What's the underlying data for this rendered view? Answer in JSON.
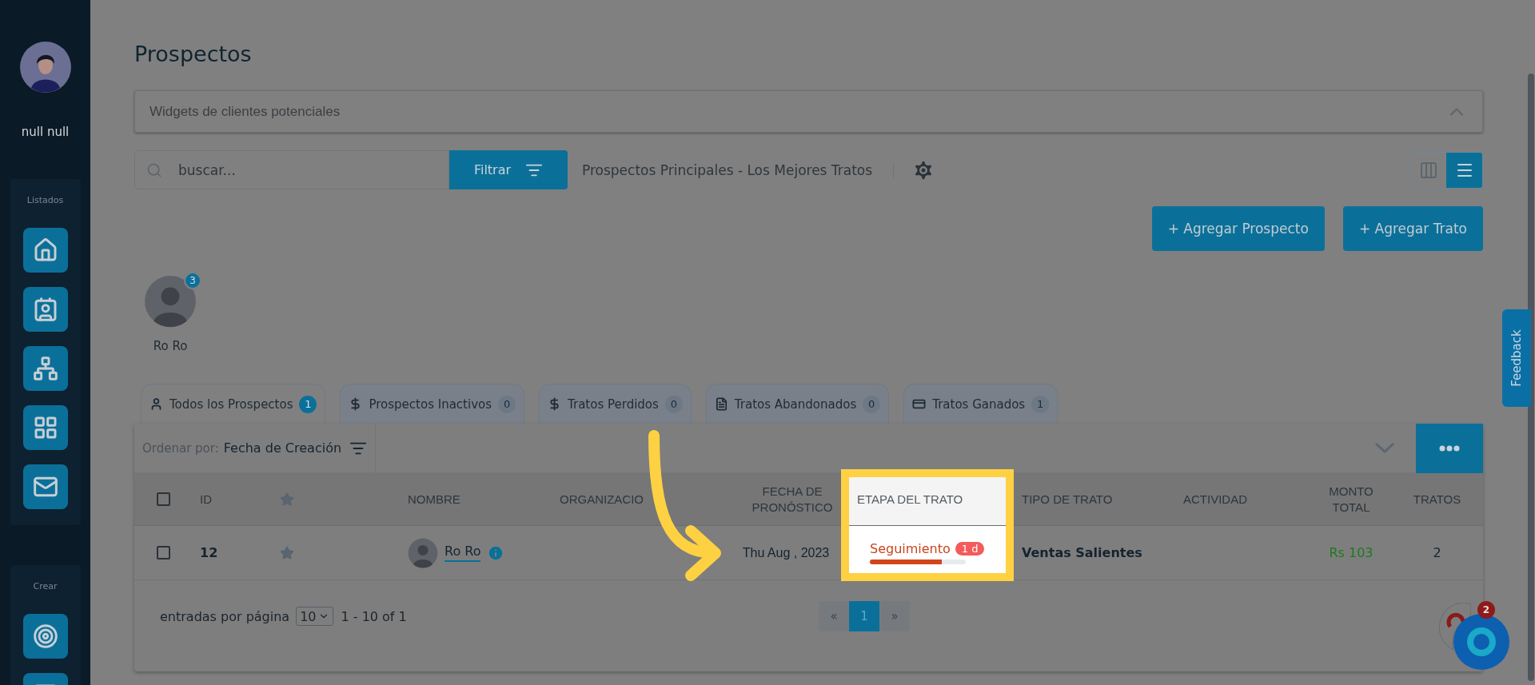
{
  "sidebar": {
    "user_name": "null null",
    "sections": [
      {
        "title": "Listados",
        "items": [
          {
            "kind": "home"
          },
          {
            "kind": "contact"
          },
          {
            "kind": "hierarchy"
          },
          {
            "kind": "grid"
          },
          {
            "kind": "mail"
          }
        ]
      },
      {
        "title": "Crear",
        "items": [
          {
            "kind": "target"
          },
          {
            "kind": "message"
          }
        ]
      }
    ]
  },
  "page_title": "Prospectos",
  "widgets_panel": {
    "title": "Widgets de clientes potenciales",
    "expanded": true
  },
  "toolbar": {
    "search": {
      "placeholder": "buscar..."
    },
    "filter_button": "Filtrar",
    "view_name": "Prospectos Principales - Los Mejores Tratos",
    "views": [
      {
        "kind": "kanban",
        "selected": false
      },
      {
        "kind": "list",
        "selected": true
      }
    ]
  },
  "actions": [
    "+ Agregar Prospecto",
    "+ Agregar Trato"
  ],
  "owners": [
    {
      "name": "Ro Ro",
      "count": "3"
    }
  ],
  "tabs": [
    {
      "kind": "user",
      "label": "Todos los Prospectos",
      "count": "1",
      "selected": true
    },
    {
      "kind": "dollar",
      "label": "Prospectos Inactivos",
      "count": "0",
      "selected": false
    },
    {
      "kind": "dollar",
      "label": "Tratos Perdidos",
      "count": "0",
      "selected": false
    },
    {
      "kind": "file",
      "label": "Tratos Abandonados",
      "count": "0",
      "selected": false
    },
    {
      "kind": "card",
      "label": "Tratos Ganados",
      "count": "1",
      "selected": false
    }
  ],
  "sort": {
    "label": "Ordenar por:",
    "value": "Fecha de Creación"
  },
  "table": {
    "columns": [
      {
        "kind": "checkbox",
        "checked": false,
        "highlighted": false
      },
      {
        "kind": "text",
        "label": "ID",
        "highlighted": false
      },
      {
        "kind": "star",
        "highlighted": false
      },
      {
        "kind": "text",
        "label": "NOMBRE",
        "highlighted": false
      },
      {
        "kind": "text",
        "label": "ORGANIZACIO",
        "highlighted": false
      },
      {
        "kind": "text",
        "label": "FECHA DE PRONÓSTICO",
        "highlighted": false
      },
      {
        "kind": "text",
        "label": "ETAPA DEL TRATO",
        "highlighted": true
      },
      {
        "kind": "text",
        "label": "TIPO DE TRATO",
        "highlighted": false
      },
      {
        "kind": "text",
        "label": "ACTIVIDAD",
        "highlighted": false
      },
      {
        "kind": "text",
        "label": "MONTO TOTAL",
        "highlighted": false
      },
      {
        "kind": "text",
        "label": "TRATOS",
        "highlighted": false
      }
    ],
    "rows": [
      {
        "selected": false,
        "id": "12",
        "starred": false,
        "name": "Ro Ro",
        "date": "Thu Aug , 2023",
        "stage": {
          "label": "Seguimiento",
          "age": "1 d",
          "level": 0.75
        },
        "deal_type": "Ventas Salientes",
        "amount": "Rs 103",
        "deals": "2"
      }
    ]
  },
  "footer": {
    "per_page_label": "entradas por página",
    "per_page": "10",
    "range": "1 - 10 of 1",
    "pages": [
      {
        "label": "«",
        "selected": false
      },
      {
        "label": "1",
        "selected": true
      },
      {
        "label": "»",
        "selected": false
      }
    ]
  },
  "feedback": "Feedback",
  "chat": {
    "badge": "2"
  }
}
